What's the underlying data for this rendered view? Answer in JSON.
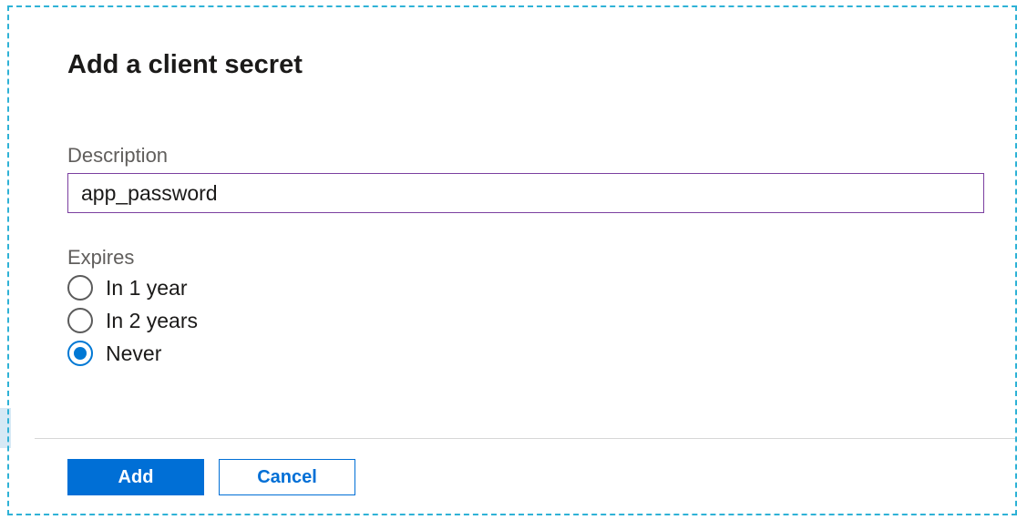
{
  "panel": {
    "title": "Add a client secret",
    "description": {
      "label": "Description",
      "value": "app_password"
    },
    "expires": {
      "label": "Expires",
      "options": [
        {
          "label": "In 1 year",
          "selected": false
        },
        {
          "label": "In 2 years",
          "selected": false
        },
        {
          "label": "Never",
          "selected": true
        }
      ]
    },
    "actions": {
      "add": "Add",
      "cancel": "Cancel"
    }
  },
  "colors": {
    "accent": "#006fd6",
    "inputBorder": "#7b3fa0",
    "dashedBorder": "#2fb2d6"
  }
}
